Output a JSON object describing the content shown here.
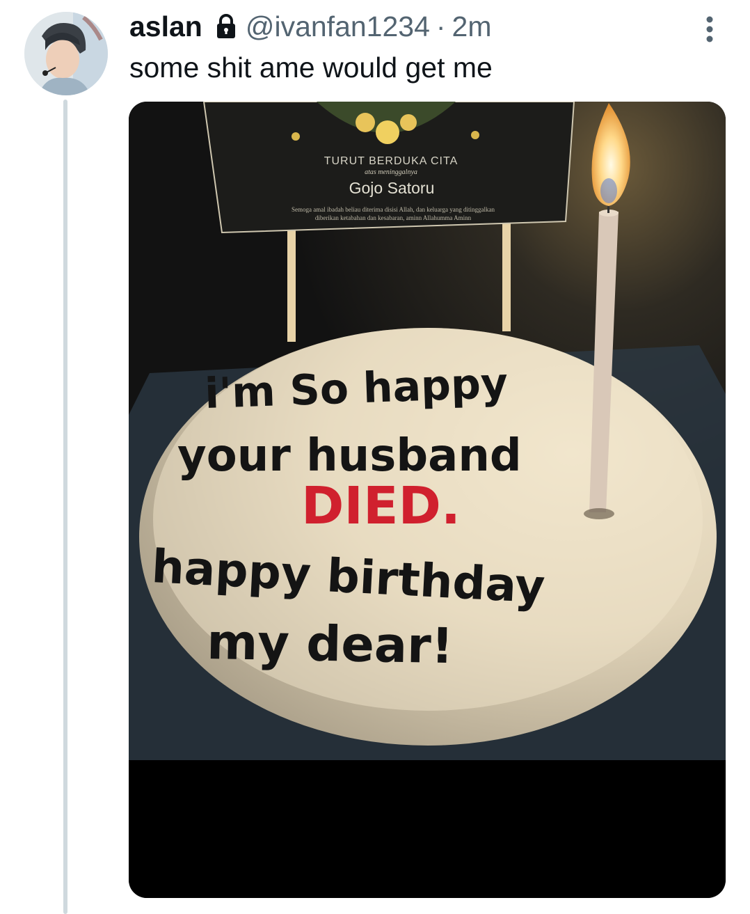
{
  "tweet": {
    "display_name": "aslan",
    "handle": "@ivanfan1234",
    "separator": "·",
    "time": "2m",
    "text": "some shit ame would get me",
    "icons": {
      "lock": "lock-icon",
      "more": "more-vertical-icon"
    }
  },
  "photo": {
    "card": {
      "heading": "TURUT BERDUKA CITA",
      "subheading": "atas meninggalnya",
      "name": "Gojo Satoru",
      "prayer_line1": "Semoga amal ibadah beliau diterima disisi Allah, dan keluarga yang ditinggalkan",
      "prayer_line2": "diberikan ketabahan dan kesabaran, aminn Allahumma Aminn"
    },
    "cake": {
      "line1": "i'm So happy",
      "line2": "your husband",
      "line3": "DIED.",
      "line4": "happy birthday",
      "line5": "my dear!"
    }
  },
  "colors": {
    "text_primary": "#0f1419",
    "text_secondary": "#536471",
    "thread_line": "#cfd9de",
    "icing_red": "#d0202e",
    "icing_dark": "#141414"
  }
}
